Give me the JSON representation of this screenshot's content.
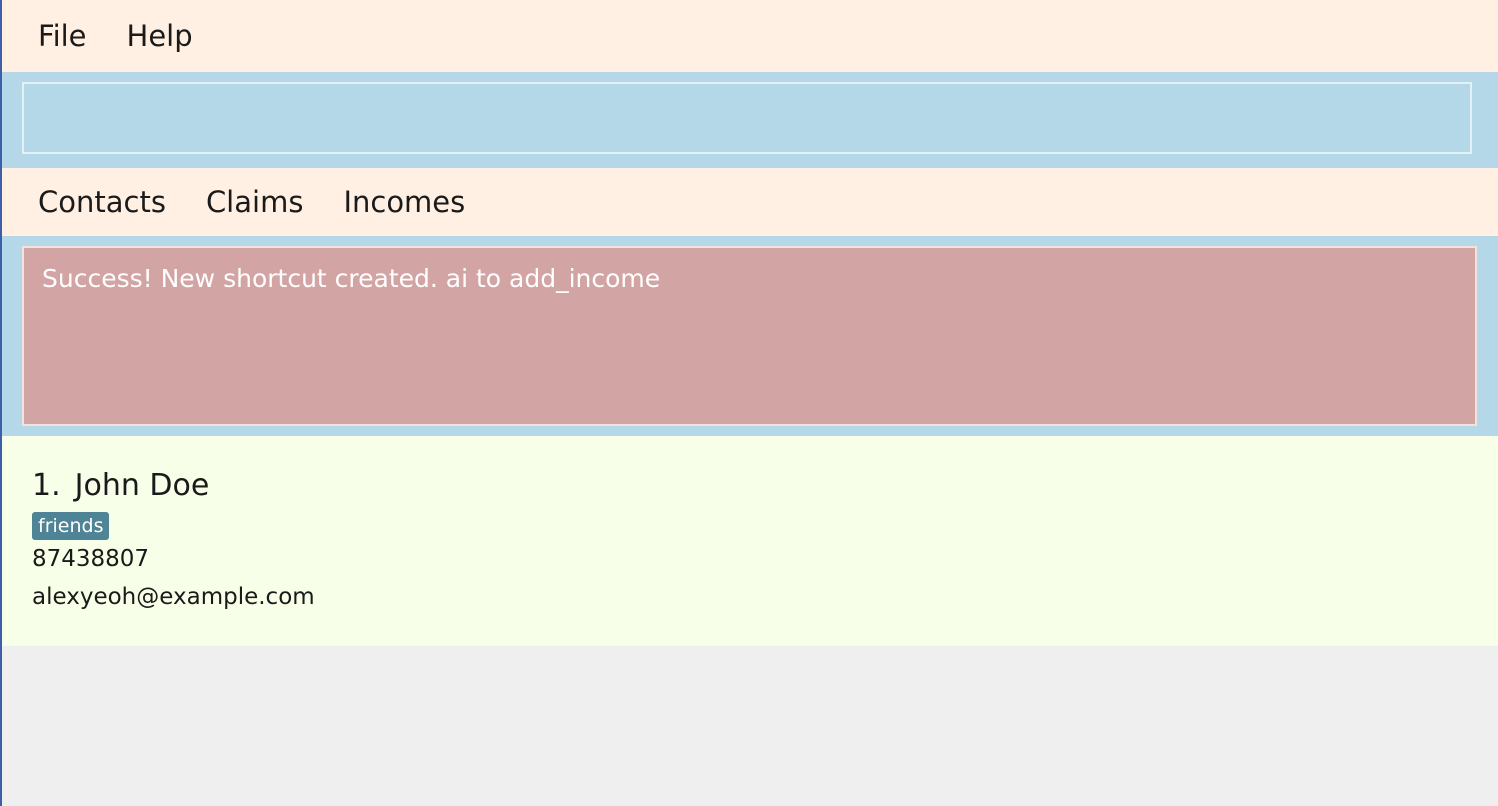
{
  "menu": {
    "items": [
      "File",
      "Help"
    ]
  },
  "command": {
    "value": "",
    "placeholder": ""
  },
  "tabs": [
    "Contacts",
    "Claims",
    "Incomes"
  ],
  "result": {
    "message": "Success! New shortcut created. ai to add_income"
  },
  "contacts": [
    {
      "index": "1.",
      "name": "John Doe",
      "tags": [
        "friends"
      ],
      "phone": "87438807",
      "email": "alexyeoh@example.com"
    }
  ],
  "colors": {
    "menu_bg": "#fff0e3",
    "command_bg": "#b4d8e8",
    "result_bg": "#d3a4a4",
    "list_bg": "#f8ffe8",
    "tag_bg": "#4e8496",
    "window_bg": "#efefef"
  }
}
